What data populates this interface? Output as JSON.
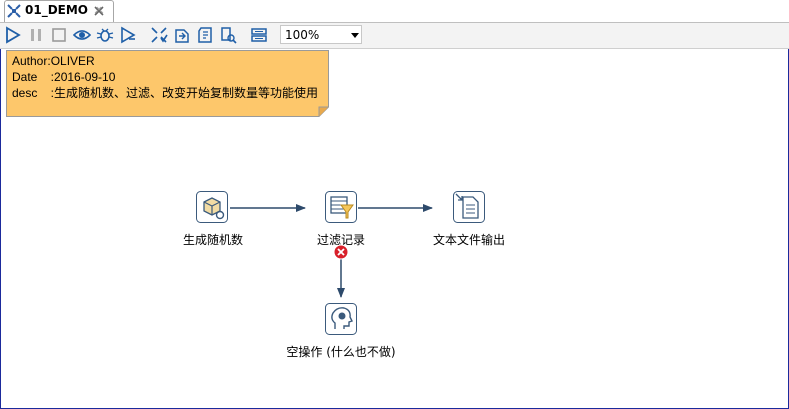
{
  "tab": {
    "title": "01_DEMO",
    "icon": "transformation-icon",
    "close_icon": "close-tab-icon"
  },
  "toolbar": {
    "buttons": [
      {
        "name": "run-button",
        "icon": "play-icon"
      },
      {
        "name": "pause-button",
        "icon": "pause-icon"
      },
      {
        "name": "stop-button",
        "icon": "stop-icon"
      },
      {
        "name": "preview-button",
        "icon": "eye-icon"
      },
      {
        "name": "debug-button",
        "icon": "bug-icon"
      },
      {
        "name": "replay-button",
        "icon": "replay-icon"
      },
      {
        "name": "verify-button",
        "icon": "verify-icon"
      },
      {
        "name": "impact-button",
        "icon": "impact-icon"
      },
      {
        "name": "sql-button",
        "icon": "sql-icon"
      },
      {
        "name": "explore-db-button",
        "icon": "explore-db-icon"
      },
      {
        "name": "layout-button",
        "icon": "layout-icon"
      }
    ],
    "zoom": "100%"
  },
  "note": {
    "lines": [
      "Author:OLIVER",
      "Date    :2016-09-10",
      "desc    :生成随机数、过滤、改变开始复制数量等功能使用"
    ],
    "color": "#fdc76b"
  },
  "steps": [
    {
      "id": "random",
      "label": "生成随机数",
      "icon": "random-generator-icon"
    },
    {
      "id": "filter",
      "label": "过滤记录",
      "icon": "filter-rows-icon"
    },
    {
      "id": "output",
      "label": "文本文件输出",
      "icon": "text-file-output-icon"
    },
    {
      "id": "dummy",
      "label": "空操作 (什么也不做)",
      "icon": "dummy-step-icon"
    }
  ],
  "colors": {
    "hop": "#2d4a6b",
    "error": "#d8202a",
    "frame": "#1b2a9c"
  }
}
